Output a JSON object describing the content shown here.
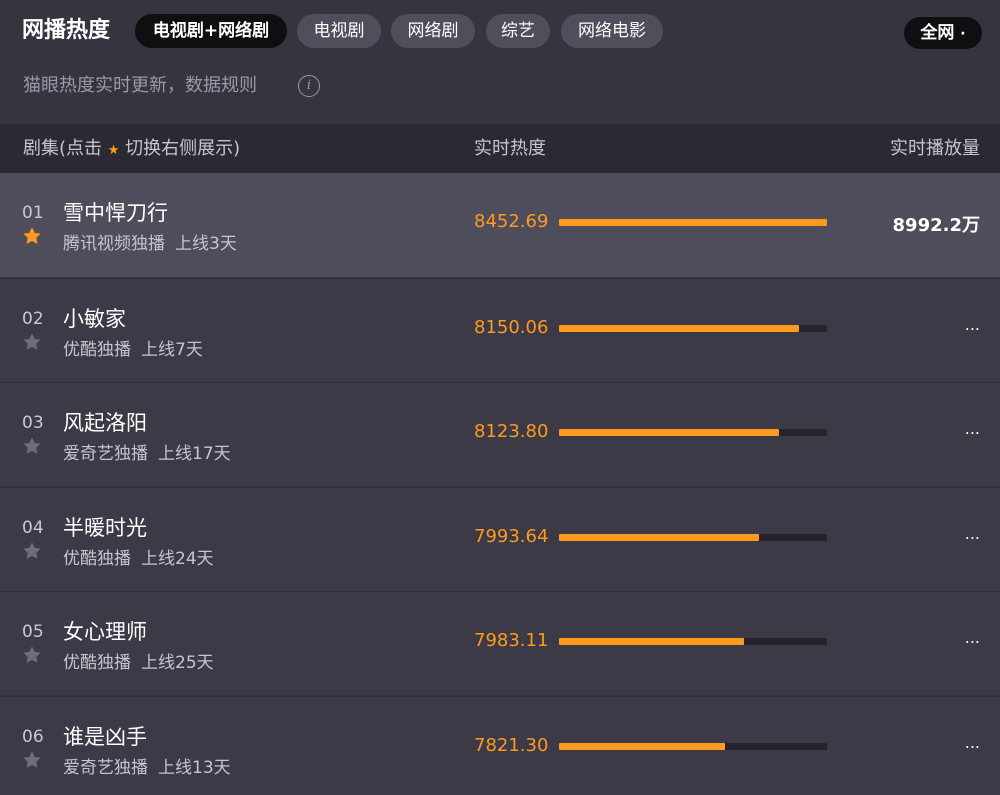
{
  "header": {
    "title": "网播热度",
    "tabs": [
      {
        "label": "电视剧+网络剧",
        "active": true
      },
      {
        "label": "电视剧",
        "active": false
      },
      {
        "label": "网络剧",
        "active": false
      },
      {
        "label": "综艺",
        "active": false
      },
      {
        "label": "网络电影",
        "active": false
      }
    ],
    "scope_label": "全网",
    "scope_caret": "·",
    "subtitle": "猫眼热度实时更新，数据规则",
    "info_icon": "info-icon",
    "info_glyph": "i"
  },
  "columns": {
    "series_prefix": "剧集(点击",
    "series_star": "★",
    "series_suffix": "切换右侧展示)",
    "heat": "实时热度",
    "plays": "实时播放量"
  },
  "colors": {
    "accent": "#ff9a1f",
    "background": "#35343f",
    "row": "#3b3a46",
    "row_highlight": "#4e4d5b",
    "track": "#25242c"
  },
  "rows": [
    {
      "rank": "01",
      "name": "雪中悍刀行",
      "platform": "腾讯视频独播",
      "online": "上线3天",
      "heat": "8452.69",
      "heat_fraction": 1.0,
      "plays": "8992.2万",
      "starred": true
    },
    {
      "rank": "02",
      "name": "小敏家",
      "platform": "优酷独播",
      "online": "上线7天",
      "heat": "8150.06",
      "heat_fraction": 0.895,
      "plays": "...",
      "starred": false
    },
    {
      "rank": "03",
      "name": "风起洛阳",
      "platform": "爱奇艺独播",
      "online": "上线17天",
      "heat": "8123.80",
      "heat_fraction": 0.82,
      "plays": "...",
      "starred": false
    },
    {
      "rank": "04",
      "name": "半暖时光",
      "platform": "优酷独播",
      "online": "上线24天",
      "heat": "7993.64",
      "heat_fraction": 0.745,
      "plays": "...",
      "starred": false
    },
    {
      "rank": "05",
      "name": "女心理师",
      "platform": "优酷独播",
      "online": "上线25天",
      "heat": "7983.11",
      "heat_fraction": 0.69,
      "plays": "...",
      "starred": false
    },
    {
      "rank": "06",
      "name": "谁是凶手",
      "platform": "爱奇艺独播",
      "online": "上线13天",
      "heat": "7821.30",
      "heat_fraction": 0.62,
      "plays": "...",
      "starred": false
    }
  ]
}
